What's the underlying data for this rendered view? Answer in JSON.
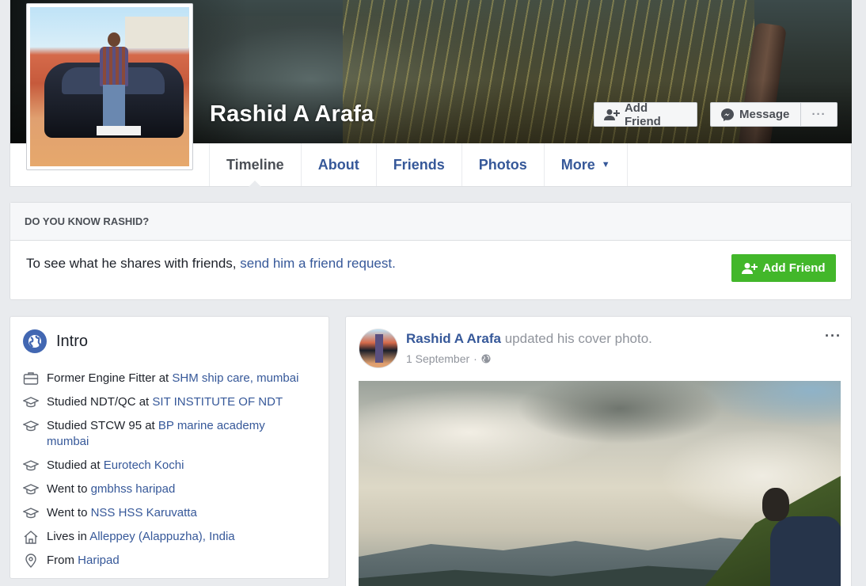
{
  "profile": {
    "name": "Rashid A Arafa",
    "actions": {
      "add_friend": "Add Friend",
      "message": "Message",
      "more": "···"
    },
    "tabs": [
      {
        "label": "Timeline"
      },
      {
        "label": "About"
      },
      {
        "label": "Friends"
      },
      {
        "label": "Photos"
      },
      {
        "label": "More"
      }
    ]
  },
  "know": {
    "heading": "DO YOU KNOW RASHID?",
    "text_prefix": "To see what he shares with friends, ",
    "link_text": "send him a friend request.",
    "button": "Add Friend"
  },
  "intro": {
    "title": "Intro",
    "items": [
      {
        "icon": "briefcase-icon",
        "prefix": "Former Engine Fitter at ",
        "link": "SHM ship care, mumbai"
      },
      {
        "icon": "graduation-cap-icon",
        "prefix": "Studied NDT/QC at ",
        "link": "SIT INSTITUTE OF NDT"
      },
      {
        "icon": "graduation-cap-icon",
        "prefix": "Studied STCW 95 at ",
        "link": "BP marine academy mumbai"
      },
      {
        "icon": "graduation-cap-icon",
        "prefix": "Studied at ",
        "link": "Eurotech Kochi"
      },
      {
        "icon": "graduation-cap-icon",
        "prefix": "Went to ",
        "link": "gmbhss haripad"
      },
      {
        "icon": "graduation-cap-icon",
        "prefix": "Went to ",
        "link": "NSS HSS Karuvatta"
      },
      {
        "icon": "home-icon",
        "prefix": "Lives in ",
        "link": "Alleppey (Alappuzha), India"
      },
      {
        "icon": "location-pin-icon",
        "prefix": "From ",
        "link": "Haripad"
      }
    ]
  },
  "post": {
    "author": "Rashid A Arafa",
    "action": " updated his cover photo.",
    "date": "1 September",
    "separator": "·",
    "privacy_icon": "globe-icon",
    "options": "···"
  },
  "colors": {
    "link": "#365899",
    "background": "#e9ebee",
    "green": "#42b72a",
    "accent": "#4267b2"
  }
}
